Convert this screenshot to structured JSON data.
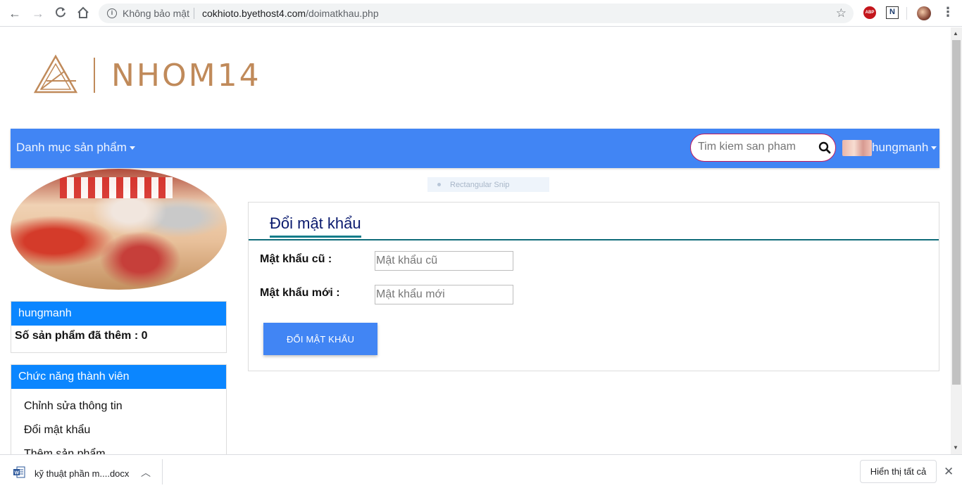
{
  "browser": {
    "security_label": "Không bảo mật",
    "url_host": "cokhioto.byethost4.com",
    "url_path": "/doimatkhau.php",
    "ext_abp": "ABP",
    "ext_n": "N"
  },
  "site": {
    "logo_text": "NHOM14",
    "nav_menu_label": "Danh mục sản phẩm",
    "search_placeholder": "Tim kiem san pham",
    "user_name": "hungmanh",
    "snip_label": "Rectangular Snip"
  },
  "sidebar": {
    "user_panel_title": "hungmanh",
    "products_added_text": "Số sản phẩm đã thêm : 0",
    "member_panel_title": "Chức năng thành viên",
    "member_items": [
      "Chỉnh sửa thông tin",
      "Đổi mật khẩu",
      "Thêm sản phẩm"
    ]
  },
  "form": {
    "tab_title": "Đổi mật khẩu",
    "old_label": "Mật khẩu cũ :",
    "old_placeholder": "Mật khẩu cũ",
    "new_label": "Mật khẩu mới :",
    "new_placeholder": "Mật khẩu mới",
    "submit_label": "ĐỔI MẬT KHẨU"
  },
  "downloads": {
    "file_name": "kỹ thuật phần m....docx",
    "show_all": "Hiển thị tất cả"
  },
  "colors": {
    "navbar": "#4185f4",
    "panel_head": "#0b86ff",
    "logo": "#c08a5a",
    "tab_title": "#0a1a6e"
  }
}
